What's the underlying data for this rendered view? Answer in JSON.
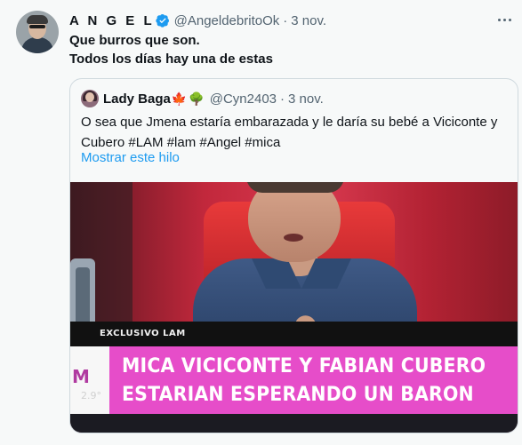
{
  "tweet": {
    "display_name": "A N G E L",
    "handle": "@AngeldebritoOk",
    "separator": "·",
    "time": "3 nov.",
    "text_lines": [
      "Que burros que son.",
      "Todos los días hay una de estas"
    ]
  },
  "quoted": {
    "display_name": "Lady Baga",
    "name_emoji_1": "🍁",
    "name_emoji_2": "🌳",
    "handle": "@Cyn2403",
    "separator": "·",
    "time": "3 nov.",
    "text": "O sea que Jmena estaría embarazada y le daría su bebé a Viciconte y Cubero #LAM #lam #Angel #mica",
    "show_thread_label": "Mostrar este hilo",
    "media": {
      "label_exclusivo": "EXCLUSIVO LAM",
      "headline_line1": "MICA VICICONTE Y FABIAN CUBERO",
      "headline_line2": "ESTARIAN ESPERANDO UN BARON",
      "side_logo": "M",
      "side_temp": "2.9°"
    }
  },
  "colors": {
    "verified": "#1d9bf0",
    "link": "#1d9bf0",
    "banner": "#e64dc9",
    "chair": "#e83a3a"
  },
  "icons": {
    "verified": "verified-badge-icon",
    "more": "more-dots-icon"
  }
}
